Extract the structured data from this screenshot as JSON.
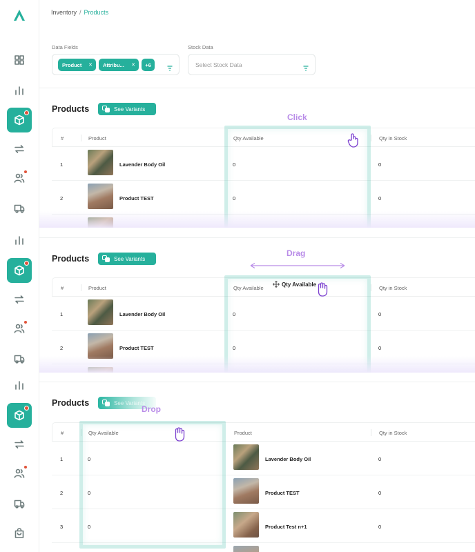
{
  "breadcrumb": {
    "parent": "Inventory",
    "separator": "/",
    "current": "Products"
  },
  "filters": {
    "data_fields_label": "Data Fields",
    "chips": [
      "Product",
      "Attribu...",
      "+6"
    ],
    "stock_data_label": "Stock Data",
    "stock_placeholder": "Select Stock Data"
  },
  "section": {
    "title": "Products",
    "see_variants": "See Variants"
  },
  "annotations": {
    "click": "Click",
    "drag": "Drag",
    "drop": "Drop"
  },
  "columns": {
    "index": "#",
    "product": "Product",
    "qty_available": "Qty Available",
    "qty_in_stock": "Qty in Stock"
  },
  "dragged_header": "Qty Available",
  "rows": [
    {
      "index": "1",
      "name": "Lavender Body Oil",
      "qty_available": "0",
      "qty_in_stock": "0"
    },
    {
      "index": "2",
      "name": "Product TEST",
      "qty_available": "0",
      "qty_in_stock": "0"
    },
    {
      "index": "3",
      "name": "Product Test n+1",
      "qty_available": "0",
      "qty_in_stock": "0"
    }
  ],
  "colors": {
    "accent": "#26b09c",
    "annotation": "#b98ce8",
    "badge": "#e0533a"
  }
}
